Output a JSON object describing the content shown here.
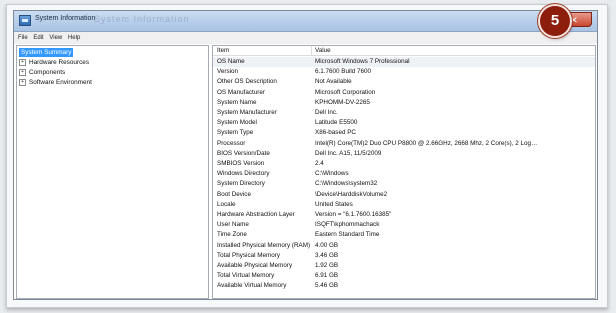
{
  "window": {
    "title": "System Information",
    "title_echo": "System Information",
    "close_glyph": "✕"
  },
  "step_badge": "5",
  "menu": [
    "File",
    "Edit",
    "View",
    "Help"
  ],
  "tree": {
    "root": "System Summary",
    "children": [
      "Hardware Resources",
      "Components",
      "Software Environment"
    ],
    "expander_glyph": "+"
  },
  "table": {
    "headers": [
      "Item",
      "Value"
    ],
    "rows": [
      [
        "OS Name",
        "Microsoft Windows 7 Professional"
      ],
      [
        "Version",
        "6.1.7600 Build 7600"
      ],
      [
        "Other OS Description",
        "Not Available"
      ],
      [
        "OS Manufacturer",
        "Microsoft Corporation"
      ],
      [
        "System Name",
        "KPHOMM-DV-2265"
      ],
      [
        "System Manufacturer",
        "Dell Inc."
      ],
      [
        "System Model",
        "Latitude E5500"
      ],
      [
        "System Type",
        "X86-based PC"
      ],
      [
        "Processor",
        "Intel(R) Core(TM)2 Duo CPU      P8800  @ 2.66GHz, 2668 Mhz, 2 Core(s), 2 Log…"
      ],
      [
        "BIOS Version/Date",
        "Dell Inc. A15, 11/5/2009"
      ],
      [
        "SMBIOS Version",
        "2.4"
      ],
      [
        "Windows Directory",
        "C:\\Windows"
      ],
      [
        "System Directory",
        "C:\\Windows\\system32"
      ],
      [
        "Boot Device",
        "\\Device\\HarddiskVolume2"
      ],
      [
        "Locale",
        "United States"
      ],
      [
        "Hardware Abstraction Layer",
        "Version = \"6.1.7600.16385\""
      ],
      [
        "User Name",
        "ISQFT\\kphommachack"
      ],
      [
        "Time Zone",
        "Eastern Standard Time"
      ],
      [
        "Installed Physical Memory (RAM)",
        "4.00 GB"
      ],
      [
        "Total Physical Memory",
        "3.46 GB"
      ],
      [
        "Available Physical Memory",
        "1.92 GB"
      ],
      [
        "Total Virtual Memory",
        "6.91 GB"
      ],
      [
        "Available Virtual Memory",
        "5.46 GB"
      ]
    ]
  },
  "colors": {
    "selection": "#3399ff",
    "badge": "#8d1d0d",
    "close": "#c8452f"
  }
}
